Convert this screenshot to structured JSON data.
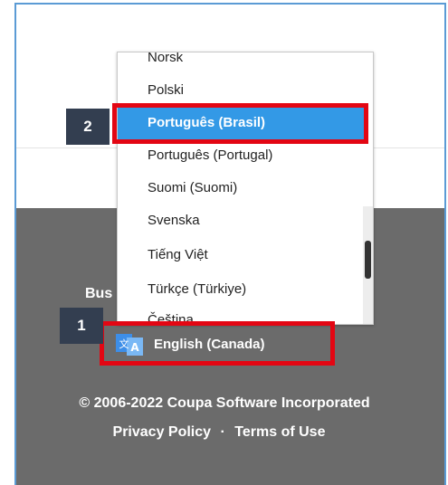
{
  "footer": {
    "truncated_text": "Bus",
    "language_button_label": "English (Canada)",
    "copyright": "© 2006-2022 Coupa Software Incorporated",
    "privacy_link": "Privacy Policy",
    "links_separator": "·",
    "terms_link": "Terms of Use"
  },
  "language_dropdown": {
    "options": [
      "Norsk",
      "Polski",
      "Português (Brasil)",
      "Português (Portugal)",
      "Suomi (Suomi)",
      "Svenska",
      "Tiếng Việt",
      "Türkçe (Türkiye)",
      "Čeština"
    ],
    "selected": "Português (Brasil)"
  },
  "callouts": {
    "step1": "1",
    "step2": "2"
  },
  "colors": {
    "highlight": "#e30613",
    "selected_option": "#3399e6",
    "footer_bg": "#6b6b6b",
    "badge_bg": "#333e50"
  }
}
